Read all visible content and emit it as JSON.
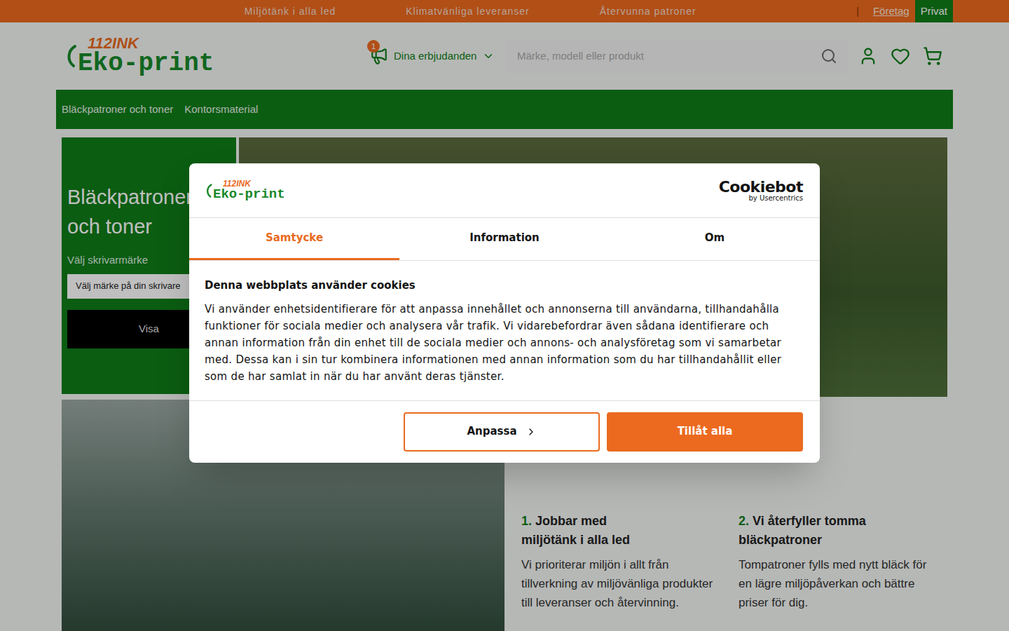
{
  "topbar": {
    "usps": [
      "Miljötänk i alla led",
      "Klimatvänliga leveranser",
      "Återvunna patroner"
    ],
    "separator": "|",
    "segments": [
      {
        "label": "Företag",
        "selected": false
      },
      {
        "label": "Privat",
        "selected": true
      }
    ]
  },
  "header": {
    "logo": {
      "top": "112INK",
      "main": "Eko-print"
    },
    "offers": {
      "label": "Dina erbjudanden",
      "badge": "1"
    },
    "search": {
      "placeholder": "Märke, modell eller produkt"
    }
  },
  "nav": [
    "Bläckpatroner och toner",
    "Kontorsmaterial"
  ],
  "hero": {
    "title": "Bläckpatroner och toner",
    "select_label": "Välj skrivarmärke",
    "select_placeholder": "Välj märke på din skrivare",
    "button": "Visa"
  },
  "steps": [
    {
      "number": "1.",
      "title": "Jobbar med miljötänk i alla led",
      "text": "Vi prioriterar miljön i allt från tillverkning av miljövänliga produkter till leveranser och återvinning."
    },
    {
      "number": "2.",
      "title": "Vi återfyller tomma bläckpatroner",
      "text": "Tompatroner fylls med nytt bläck för en lägre miljöpåverkan och bättre priser för dig."
    }
  ],
  "cookie_dialog": {
    "brand": {
      "name": "Cookiebot",
      "by": "by Usercentrics"
    },
    "tabs": [
      {
        "label": "Samtycke",
        "selected": true
      },
      {
        "label": "Information",
        "selected": false
      },
      {
        "label": "Om",
        "selected": false
      }
    ],
    "title": "Denna webbplats använder cookies",
    "body": "Vi använder enhetsidentifierare för att anpassa innehållet och annonserna till användarna, tillhandahålla funktioner för sociala medier och analysera vår trafik. Vi vidarebefordrar även sådana identifierare och annan information från din enhet till de sociala medier och annons- och analysföretag som vi samarbetar med. Dessa kan i sin tur kombinera informationen med annan information som du har tillhandahållit eller som de har samlat in när du har använt deras tjänster.",
    "buttons": [
      {
        "label": "Anpassa",
        "kind": "outline"
      },
      {
        "label": "Tillåt alla",
        "kind": "primary"
      }
    ]
  }
}
